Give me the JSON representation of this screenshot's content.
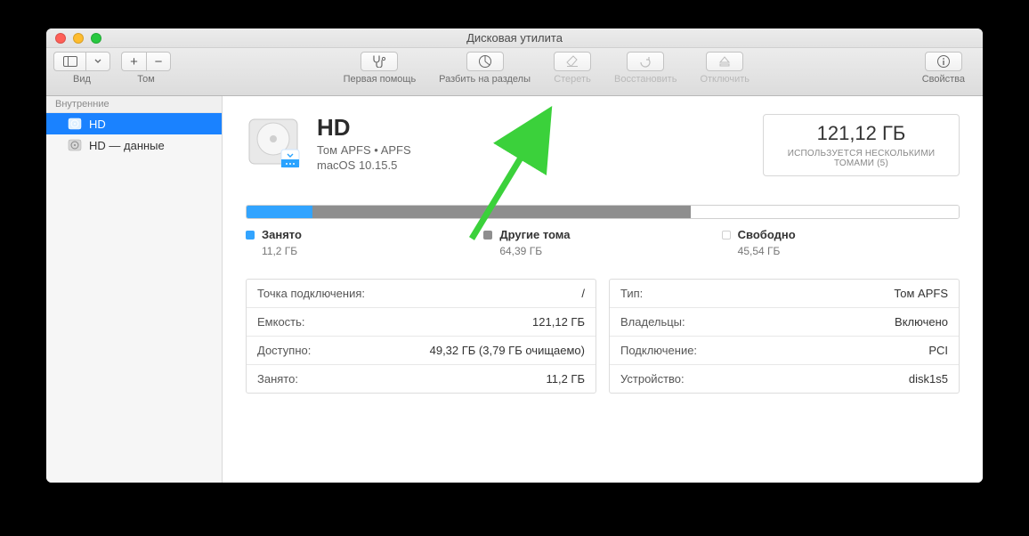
{
  "window": {
    "title": "Дисковая утилита"
  },
  "toolbar": {
    "view_label": "Вид",
    "volume_label": "Том",
    "first_aid": "Первая помощь",
    "partition": "Разбить на разделы",
    "erase": "Стереть",
    "restore": "Восстановить",
    "unmount": "Отключить",
    "info": "Свойства"
  },
  "sidebar": {
    "header": "Внутренние",
    "items": [
      {
        "label": "HD",
        "selected": true
      },
      {
        "label": "HD — данные",
        "selected": false
      }
    ]
  },
  "volume": {
    "name": "HD",
    "subtitle": "Том APFS • APFS",
    "os": "macOS 10.15.5",
    "size_main": "121,12 ГБ",
    "size_sub": "ИСПОЛЬЗУЕТСЯ НЕСКОЛЬКИМИ ТОМАМИ (5)"
  },
  "usage": {
    "used": {
      "label": "Занято",
      "value": "11,2 ГБ",
      "pct": 9.2
    },
    "other": {
      "label": "Другие тома",
      "value": "64,39 ГБ",
      "pct": 53.2
    },
    "free": {
      "label": "Свободно",
      "value": "45,54 ГБ",
      "pct": 37.6
    }
  },
  "details_left": [
    {
      "k": "Точка подключения:",
      "v": "/"
    },
    {
      "k": "Емкость:",
      "v": "121,12 ГБ"
    },
    {
      "k": "Доступно:",
      "v": "49,32 ГБ (3,79 ГБ очищаемо)"
    },
    {
      "k": "Занято:",
      "v": "11,2 ГБ"
    }
  ],
  "details_right": [
    {
      "k": "Тип:",
      "v": "Том APFS"
    },
    {
      "k": "Владельцы:",
      "v": "Включено"
    },
    {
      "k": "Подключение:",
      "v": "PCI"
    },
    {
      "k": "Устройство:",
      "v": "disk1s5"
    }
  ]
}
